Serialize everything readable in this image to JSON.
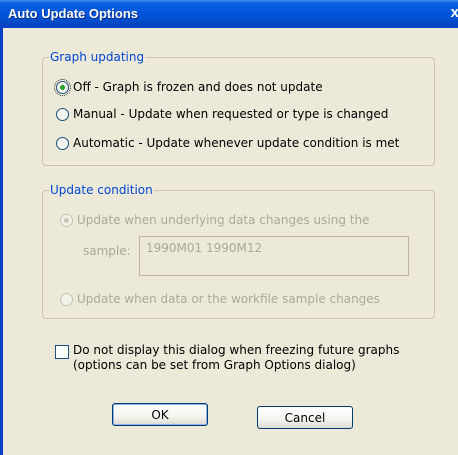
{
  "window": {
    "title": "Auto Update Options",
    "close_glyph": "x"
  },
  "graph_updating": {
    "legend": "Graph updating",
    "options": [
      {
        "label": "Off - Graph is frozen and does not update",
        "selected": true
      },
      {
        "label": "Manual - Update when requested or type is changed",
        "selected": false
      },
      {
        "label": "Automatic - Update whenever update condition is met",
        "selected": false
      }
    ]
  },
  "update_condition": {
    "legend": "Update condition",
    "enabled": false,
    "option_data_changes": "Update when underlying data changes using the",
    "sample_label": "sample:",
    "sample_value": "1990M01 1990M12",
    "option_workfile_changes": "Update when data or the workfile sample changes"
  },
  "dont_display": {
    "line1": "Do not display this dialog when freezing future graphs",
    "line2": "(options can be set from Graph Options dialog)",
    "checked": false
  },
  "buttons": {
    "ok": "OK",
    "cancel": "Cancel"
  },
  "colors": {
    "title_bar": "#0254db",
    "group_legend": "#0046d5",
    "radio_selected": "#21a121",
    "disabled_text": "#aca899",
    "dialog_bg": "#ece9d8"
  }
}
